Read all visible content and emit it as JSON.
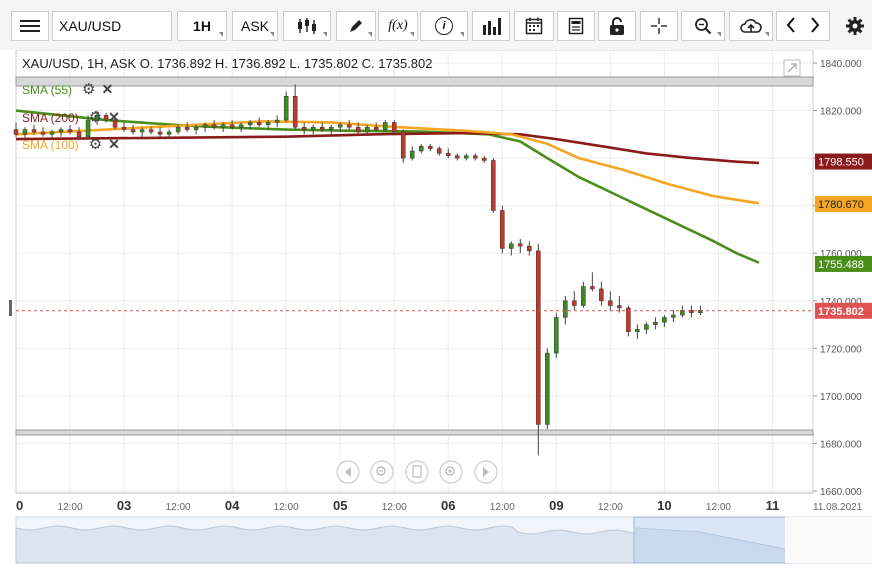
{
  "toolbar": {
    "symbol": "XAU/USD",
    "timeframe": "1H",
    "price_side": "ASK",
    "fx_label": "f(x)",
    "info_label": "i"
  },
  "chart_info": {
    "text": "XAU/USD, 1H, ASK   O. 1736.892 H. 1736.892 L. 1735.802 C. 1735.802"
  },
  "indicators": [
    {
      "label": "SMA (55)",
      "color": "#4a8f1a",
      "value": "1755.488"
    },
    {
      "label": "SMA (200)",
      "color": "#8b1a1a",
      "value": "1798.550"
    },
    {
      "label": "SMA (100)",
      "color": "#f5a623",
      "value": "1780.670"
    }
  ],
  "current_price": {
    "value": "1735.802",
    "color": "#e05252"
  },
  "chart_data": {
    "type": "line",
    "title": "XAU/USD, 1H, ASK",
    "xlabel": "",
    "ylabel": "",
    "ylim": [
      1660,
      1840
    ],
    "y_ticks": [
      "1840.000",
      "1820.000",
      "1800.000",
      "1780.000",
      "1760.000",
      "1740.000",
      "1720.000",
      "1700.000",
      "1680.000",
      "1660.000"
    ],
    "x_ticks": [
      {
        "t": 0,
        "label": "0"
      },
      {
        "t": 12,
        "label": "12:00"
      },
      {
        "t": 24,
        "label": "03"
      },
      {
        "t": 36,
        "label": "12:00"
      },
      {
        "t": 48,
        "label": "04"
      },
      {
        "t": 60,
        "label": "12:00"
      },
      {
        "t": 72,
        "label": "05"
      },
      {
        "t": 84,
        "label": "12:00"
      },
      {
        "t": 96,
        "label": "06"
      },
      {
        "t": 108,
        "label": "12:00"
      },
      {
        "t": 120,
        "label": "09"
      },
      {
        "t": 132,
        "label": "12:00"
      },
      {
        "t": 144,
        "label": "10"
      },
      {
        "t": 156,
        "label": "12:00"
      },
      {
        "t": 168,
        "label": "11"
      },
      {
        "t": 179,
        "label": "11.08.2021"
      }
    ],
    "series": [
      {
        "name": "SMA (55)",
        "color": "#4a8f1a",
        "points": [
          [
            0,
            1820
          ],
          [
            10,
            1818
          ],
          [
            20,
            1816
          ],
          [
            35,
            1814
          ],
          [
            45,
            1813
          ],
          [
            60,
            1812
          ],
          [
            75,
            1811.5
          ],
          [
            90,
            1811.2
          ],
          [
            105,
            1810
          ],
          [
            112,
            1807
          ],
          [
            118,
            1800
          ],
          [
            125,
            1792
          ],
          [
            135,
            1783
          ],
          [
            145,
            1774
          ],
          [
            155,
            1765
          ],
          [
            160,
            1760
          ],
          [
            165,
            1756
          ]
        ]
      },
      {
        "name": "SMA (200)",
        "color": "#8b1a1a",
        "points": [
          [
            0,
            1808
          ],
          [
            30,
            1808.5
          ],
          [
            60,
            1809
          ],
          [
            80,
            1810
          ],
          [
            100,
            1810.5
          ],
          [
            112,
            1810
          ],
          [
            120,
            1808
          ],
          [
            130,
            1805
          ],
          [
            140,
            1802
          ],
          [
            150,
            1800
          ],
          [
            160,
            1798.5
          ],
          [
            165,
            1798
          ]
        ]
      },
      {
        "name": "SMA (100)",
        "color": "#f5a623",
        "points": [
          [
            0,
            1810
          ],
          [
            20,
            1812
          ],
          [
            40,
            1814
          ],
          [
            55,
            1815.5
          ],
          [
            70,
            1815
          ],
          [
            85,
            1813
          ],
          [
            100,
            1811.5
          ],
          [
            110,
            1810
          ],
          [
            118,
            1806
          ],
          [
            125,
            1800
          ],
          [
            135,
            1795
          ],
          [
            145,
            1789
          ],
          [
            155,
            1784
          ],
          [
            165,
            1781
          ]
        ]
      }
    ],
    "candles": [
      [
        0,
        1812,
        1815,
        1809,
        1810
      ],
      [
        2,
        1810,
        1813,
        1808,
        1812
      ],
      [
        4,
        1812,
        1814,
        1810,
        1811
      ],
      [
        6,
        1811,
        1813,
        1809,
        1810
      ],
      [
        8,
        1810,
        1812,
        1808,
        1811
      ],
      [
        10,
        1811,
        1813,
        1809,
        1812
      ],
      [
        12,
        1812,
        1814,
        1810,
        1811
      ],
      [
        14,
        1811,
        1813,
        1808,
        1809
      ],
      [
        16,
        1809,
        1818,
        1808,
        1816
      ],
      [
        18,
        1816,
        1820,
        1814,
        1818
      ],
      [
        20,
        1818,
        1819,
        1815,
        1816
      ],
      [
        22,
        1816,
        1817,
        1812,
        1813
      ],
      [
        24,
        1813,
        1815,
        1811,
        1812
      ],
      [
        26,
        1812,
        1814,
        1810,
        1811
      ],
      [
        28,
        1811,
        1813,
        1809,
        1812
      ],
      [
        30,
        1812,
        1813,
        1810,
        1811
      ],
      [
        32,
        1811,
        1813,
        1809,
        1810
      ],
      [
        34,
        1810,
        1812,
        1808,
        1811
      ],
      [
        36,
        1811,
        1814,
        1810,
        1813
      ],
      [
        38,
        1813,
        1815,
        1811,
        1812
      ],
      [
        40,
        1812,
        1814,
        1810,
        1813
      ],
      [
        42,
        1813,
        1815,
        1811,
        1814
      ],
      [
        44,
        1814,
        1816,
        1812,
        1813
      ],
      [
        46,
        1813,
        1815,
        1811,
        1814
      ],
      [
        48,
        1814,
        1816,
        1812,
        1813
      ],
      [
        50,
        1813,
        1815,
        1811,
        1814
      ],
      [
        52,
        1814,
        1816,
        1812,
        1815
      ],
      [
        54,
        1815,
        1817,
        1813,
        1814
      ],
      [
        56,
        1814,
        1816,
        1812,
        1815
      ],
      [
        58,
        1815,
        1818,
        1813,
        1816
      ],
      [
        60,
        1816,
        1828,
        1815,
        1826
      ],
      [
        62,
        1826,
        1831,
        1812,
        1813
      ],
      [
        64,
        1813,
        1815,
        1810,
        1812
      ],
      [
        66,
        1812,
        1814,
        1810,
        1813
      ],
      [
        68,
        1813,
        1815,
        1811,
        1812
      ],
      [
        70,
        1812,
        1814,
        1810,
        1813
      ],
      [
        72,
        1813,
        1815,
        1811,
        1814
      ],
      [
        74,
        1814,
        1816,
        1812,
        1813
      ],
      [
        76,
        1813,
        1815,
        1810,
        1811
      ],
      [
        78,
        1811,
        1814,
        1810,
        1813
      ],
      [
        80,
        1813,
        1815,
        1811,
        1812
      ],
      [
        82,
        1812,
        1816,
        1811,
        1815
      ],
      [
        84,
        1815,
        1816,
        1810,
        1811
      ],
      [
        86,
        1811,
        1812,
        1798,
        1800
      ],
      [
        88,
        1800,
        1805,
        1799,
        1803
      ],
      [
        90,
        1803,
        1806,
        1802,
        1805
      ],
      [
        92,
        1805,
        1806,
        1803,
        1804
      ],
      [
        94,
        1804,
        1805,
        1801,
        1802
      ],
      [
        96,
        1802,
        1804,
        1800,
        1801
      ],
      [
        98,
        1801,
        1802,
        1799,
        1800
      ],
      [
        100,
        1800,
        1802,
        1799,
        1801
      ],
      [
        102,
        1801,
        1802,
        1799,
        1800
      ],
      [
        104,
        1800,
        1801,
        1798,
        1799
      ],
      [
        106,
        1799,
        1800,
        1777,
        1778
      ],
      [
        108,
        1778,
        1780,
        1760,
        1762
      ],
      [
        110,
        1762,
        1765,
        1759,
        1764
      ],
      [
        112,
        1764,
        1766,
        1760,
        1763
      ],
      [
        114,
        1763,
        1765,
        1759,
        1761
      ],
      [
        116,
        1761,
        1764,
        1675,
        1688
      ],
      [
        118,
        1688,
        1720,
        1686,
        1718
      ],
      [
        120,
        1718,
        1735,
        1716,
        1733
      ],
      [
        122,
        1733,
        1742,
        1730,
        1740
      ],
      [
        124,
        1740,
        1744,
        1736,
        1738
      ],
      [
        126,
        1738,
        1748,
        1737,
        1746
      ],
      [
        128,
        1746,
        1752,
        1744,
        1745
      ],
      [
        130,
        1745,
        1748,
        1738,
        1740
      ],
      [
        132,
        1740,
        1744,
        1736,
        1738
      ],
      [
        134,
        1738,
        1742,
        1735,
        1737
      ],
      [
        136,
        1737,
        1738,
        1725,
        1727
      ],
      [
        138,
        1727,
        1730,
        1724,
        1728
      ],
      [
        140,
        1728,
        1731,
        1726,
        1730
      ],
      [
        142,
        1730,
        1733,
        1728,
        1731
      ],
      [
        144,
        1731,
        1734,
        1729,
        1733
      ],
      [
        146,
        1733,
        1736,
        1731,
        1734
      ],
      [
        148,
        1734,
        1738,
        1733,
        1736
      ],
      [
        150,
        1736,
        1738,
        1733,
        1735
      ],
      [
        152,
        1735,
        1738,
        1734,
        1736
      ]
    ]
  }
}
